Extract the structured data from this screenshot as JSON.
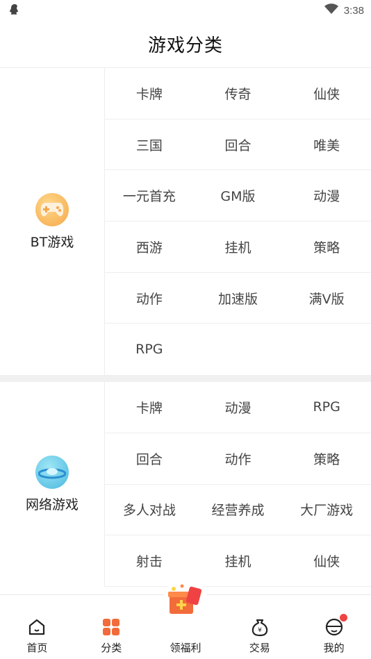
{
  "status": {
    "time": "3:38"
  },
  "header": {
    "title": "游戏分类"
  },
  "sections": [
    {
      "label": "BT游戏",
      "icon": "gamepad-icon",
      "tags": [
        "卡牌",
        "传奇",
        "仙侠",
        "三国",
        "回合",
        "唯美",
        "一元首充",
        "GM版",
        "动漫",
        "西游",
        "挂机",
        "策略",
        "动作",
        "加速版",
        "满V版",
        "RPG"
      ]
    },
    {
      "label": "网络游戏",
      "icon": "planet-icon",
      "tags": [
        "卡牌",
        "动漫",
        "RPG",
        "回合",
        "动作",
        "策略",
        "多人对战",
        "经营养成",
        "大厂游戏",
        "射击",
        "挂机",
        "仙侠"
      ]
    }
  ],
  "nav": {
    "items": [
      {
        "label": "首页",
        "icon": "home-icon"
      },
      {
        "label": "分类",
        "icon": "category-icon"
      },
      {
        "label": "领福利",
        "icon": "gift-icon"
      },
      {
        "label": "交易",
        "icon": "money-bag-icon"
      },
      {
        "label": "我的",
        "icon": "profile-icon"
      }
    ]
  },
  "colors": {
    "accent": "#f26b3a",
    "divider": "#eeeeee",
    "badge": "#f04242"
  }
}
